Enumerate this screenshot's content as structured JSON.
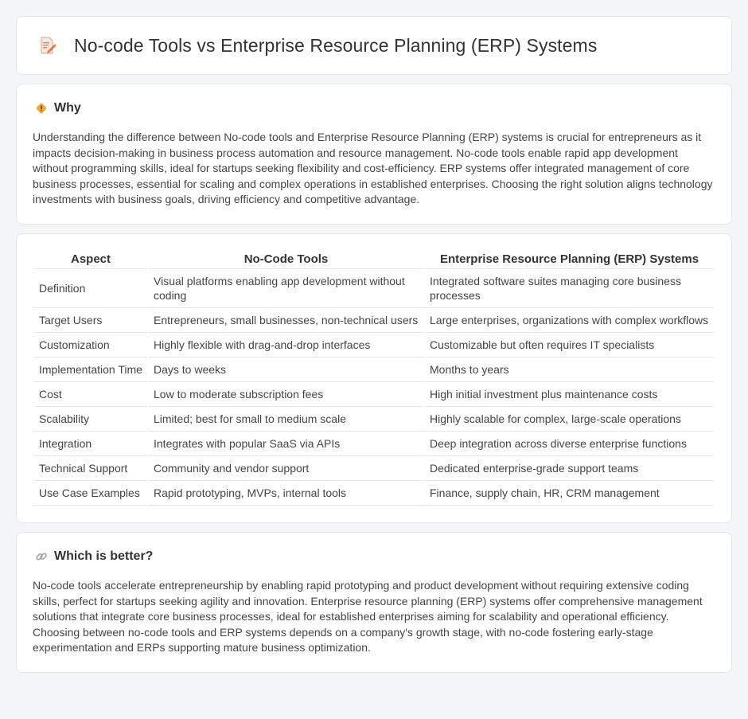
{
  "header": {
    "title": "No-code Tools vs Enterprise Resource Planning (ERP) Systems",
    "icon": "document-pencil-icon"
  },
  "why": {
    "heading": "Why",
    "icon": "diamond-warning-icon",
    "body": "Understanding the difference between No-code tools and Enterprise Resource Planning (ERP) systems is crucial for entrepreneurs as it impacts decision-making in business process automation and resource management. No-code tools enable rapid app development without programming skills, ideal for startups seeking flexibility and cost-efficiency. ERP systems offer integrated management of core business processes, essential for scaling and complex operations in established enterprises. Choosing the right solution aligns technology investments with business goals, driving efficiency and competitive advantage."
  },
  "table": {
    "headers": [
      "Aspect",
      "No-Code Tools",
      "Enterprise Resource Planning (ERP) Systems"
    ],
    "rows": [
      [
        "Definition",
        "Visual platforms enabling app development without coding",
        "Integrated software suites managing core business processes"
      ],
      [
        "Target Users",
        "Entrepreneurs, small businesses, non-technical users",
        "Large enterprises, organizations with complex workflows"
      ],
      [
        "Customization",
        "Highly flexible with drag-and-drop interfaces",
        "Customizable but often requires IT specialists"
      ],
      [
        "Implementation Time",
        "Days to weeks",
        "Months to years"
      ],
      [
        "Cost",
        "Low to moderate subscription fees",
        "High initial investment plus maintenance costs"
      ],
      [
        "Scalability",
        "Limited; best for small to medium scale",
        "Highly scalable for complex, large-scale operations"
      ],
      [
        "Integration",
        "Integrates with popular SaaS via APIs",
        "Deep integration across diverse enterprise functions"
      ],
      [
        "Technical Support",
        "Community and vendor support",
        "Dedicated enterprise-grade support teams"
      ],
      [
        "Use Case Examples",
        "Rapid prototyping, MVPs, internal tools",
        "Finance, supply chain, HR, CRM management"
      ]
    ]
  },
  "better": {
    "heading": "Which is better?",
    "icon": "link-icon",
    "body": "No-code tools accelerate entrepreneurship by enabling rapid prototyping and product development without requiring extensive coding skills, perfect for startups seeking agility and innovation. Enterprise resource planning (ERP) systems offer comprehensive management solutions that integrate core business processes, ideal for established enterprises aiming for scalability and operational efficiency. Choosing between no-code tools and ERP systems depends on a company's growth stage, with no-code fostering early-stage experimentation and ERPs supporting mature business optimization."
  }
}
